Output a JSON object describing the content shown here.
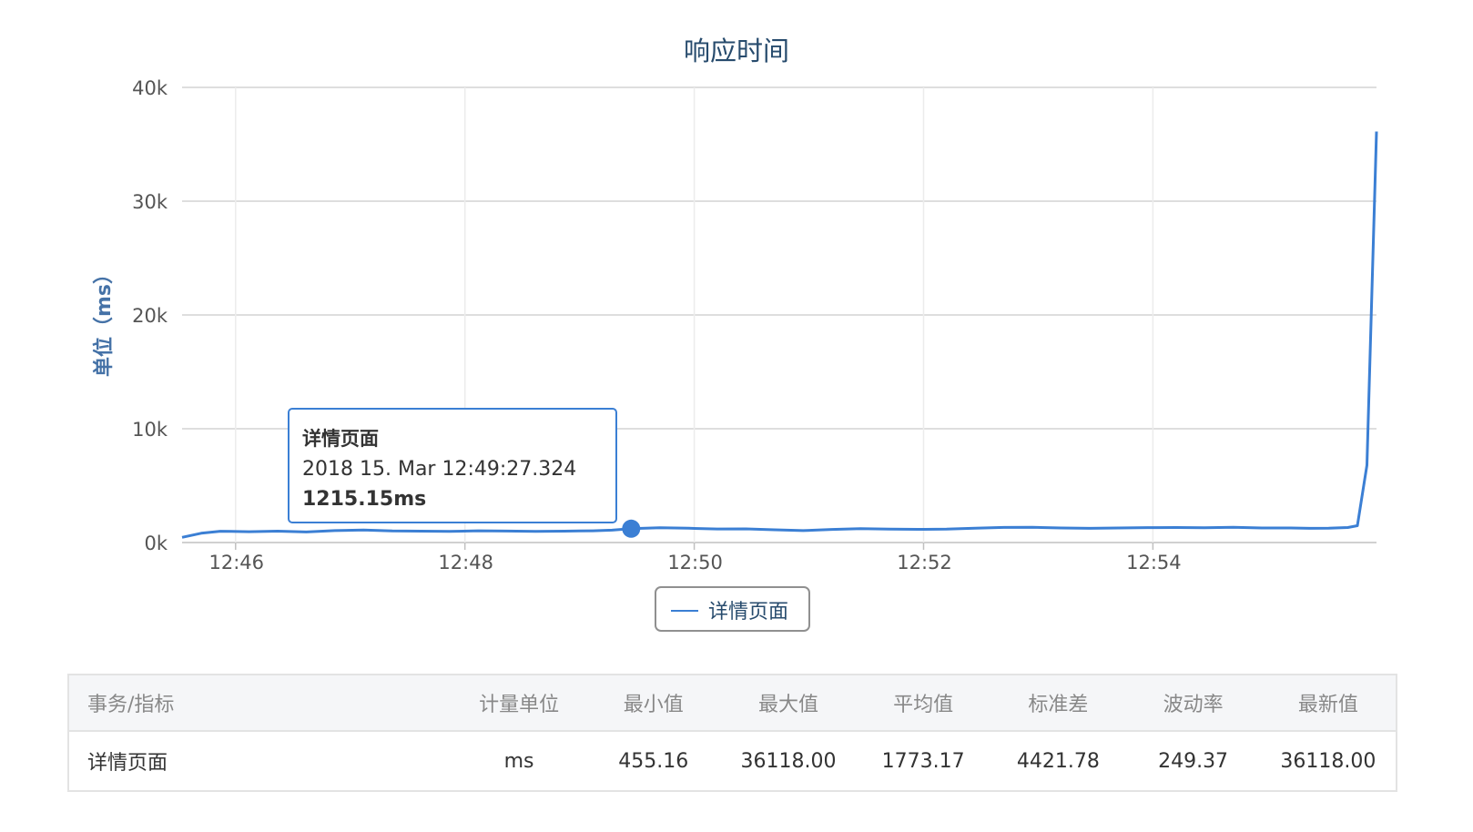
{
  "chart_data": {
    "type": "line",
    "title": "响应时间",
    "ylabel": "单位（ms）",
    "ylim": [
      0,
      40000
    ],
    "yticks": [
      {
        "value": 0,
        "label": "0k"
      },
      {
        "value": 10000,
        "label": "10k"
      },
      {
        "value": 20000,
        "label": "20k"
      },
      {
        "value": 30000,
        "label": "30k"
      },
      {
        "value": 40000,
        "label": "40k"
      }
    ],
    "xticks": [
      "12:46",
      "12:48",
      "12:50",
      "12:52",
      "12:54"
    ],
    "xlim": [
      "12:45:32",
      "12:55:57"
    ],
    "grid": true,
    "legend_position": "bottom-center",
    "series": [
      {
        "name": "详情页面",
        "color": "#3b7fd4",
        "x": [
          "12:45:32",
          "12:45:42",
          "12:45:52",
          "12:46:07",
          "12:46:22",
          "12:46:37",
          "12:46:52",
          "12:47:07",
          "12:47:22",
          "12:47:37",
          "12:47:52",
          "12:48:07",
          "12:48:22",
          "12:48:37",
          "12:48:52",
          "12:49:07",
          "12:49:17",
          "12:49:27",
          "12:49:42",
          "12:49:57",
          "12:50:12",
          "12:50:27",
          "12:50:42",
          "12:50:57",
          "12:51:12",
          "12:51:27",
          "12:51:42",
          "12:51:57",
          "12:52:12",
          "12:52:27",
          "12:52:42",
          "12:52:57",
          "12:53:12",
          "12:53:27",
          "12:53:42",
          "12:53:57",
          "12:54:12",
          "12:54:27",
          "12:54:42",
          "12:54:57",
          "12:55:12",
          "12:55:22",
          "12:55:32",
          "12:55:42",
          "12:55:47",
          "12:55:52",
          "12:55:57"
        ],
        "y": [
          455,
          820,
          990,
          950,
          1000,
          930,
          1050,
          1100,
          1020,
          1000,
          980,
          1030,
          1010,
          980,
          1000,
          1030,
          1090,
          1215,
          1300,
          1260,
          1190,
          1200,
          1120,
          1050,
          1150,
          1220,
          1180,
          1160,
          1180,
          1260,
          1330,
          1340,
          1280,
          1250,
          1280,
          1310,
          1320,
          1300,
          1340,
          1280,
          1280,
          1250,
          1260,
          1320,
          1480,
          6800,
          36118
        ]
      }
    ]
  },
  "tooltip": {
    "series_name": "详情页面",
    "timestamp": "2018 15. Mar 12:49:27.324",
    "value": "1215.15ms",
    "point_x": "12:49:27",
    "point_y": 1215.15
  },
  "stats_table": {
    "headers": [
      "事务/指标",
      "计量单位",
      "最小值",
      "最大值",
      "平均值",
      "标准差",
      "波动率",
      "最新值"
    ],
    "row": [
      "详情页面",
      "ms",
      "455.16",
      "36118.00",
      "1773.17",
      "4421.78",
      "249.37",
      "36118.00"
    ]
  }
}
